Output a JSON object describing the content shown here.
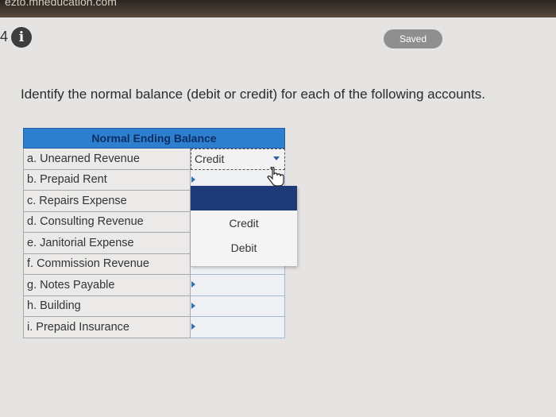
{
  "header": {
    "top_text": "ezto.mheducation.com",
    "question_number": "4",
    "info_icon": "info-icon",
    "saved_label": "Saved"
  },
  "instruction": "Identify the normal balance (debit or credit) for each of the following accounts.",
  "table": {
    "header": "Normal Ending Balance",
    "rows": [
      {
        "account": "a. Unearned Revenue",
        "value": "Credit"
      },
      {
        "account": "b. Prepaid Rent",
        "value": ""
      },
      {
        "account": "c. Repairs Expense",
        "value": ""
      },
      {
        "account": "d. Consulting Revenue",
        "value": ""
      },
      {
        "account": "e. Janitorial Expense",
        "value": ""
      },
      {
        "account": "f. Commission Revenue",
        "value": ""
      },
      {
        "account": "g. Notes Payable",
        "value": ""
      },
      {
        "account": "h. Building",
        "value": ""
      },
      {
        "account": "i. Prepaid Insurance",
        "value": ""
      }
    ]
  },
  "dropdown": {
    "options": [
      "",
      "Credit",
      "Debit"
    ],
    "highlighted_color": "#1e3a78"
  },
  "colors": {
    "table_header": "#2f7fd0",
    "saved_badge": "#8f8f8f"
  }
}
